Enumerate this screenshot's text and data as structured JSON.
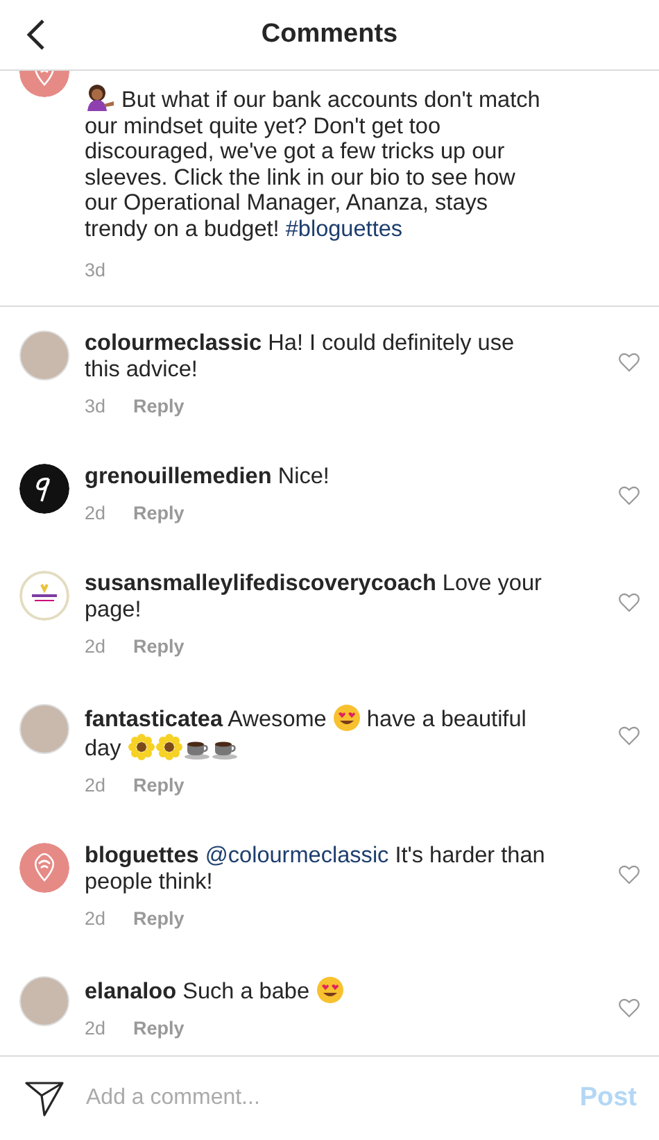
{
  "header": {
    "title": "Comments"
  },
  "caption": {
    "avatar": {
      "kind": "pink-logo"
    },
    "parts": [
      {
        "kind": "person-emoji"
      },
      {
        "kind": "text",
        "text": " But what if our bank accounts don't match our mindset quite yet? Don't get too discouraged, we've got a few tricks up our sleeves. Click the link in our bio to see how our Operational Manager, Ananza, stays trendy on a budget! "
      },
      {
        "kind": "link",
        "text": "#bloguettes"
      }
    ],
    "time": "3d"
  },
  "comments": [
    {
      "avatar": {
        "kind": "photo"
      },
      "username": "colourmeclassic",
      "parts": [
        {
          "kind": "text",
          "text": "Ha! I could definitely use this advice!"
        }
      ],
      "time": "3d",
      "reply": "Reply",
      "liked": false
    },
    {
      "avatar": {
        "kind": "dark-logo"
      },
      "username": "grenouillemedien",
      "parts": [
        {
          "kind": "text",
          "text": "Nice!"
        }
      ],
      "time": "2d",
      "reply": "Reply",
      "liked": false
    },
    {
      "avatar": {
        "kind": "light-logo"
      },
      "username": "susansmalleylifediscoverycoach",
      "parts": [
        {
          "kind": "text",
          "text": "Love your page!"
        }
      ],
      "time": "2d",
      "reply": "Reply",
      "liked": false
    },
    {
      "avatar": {
        "kind": "photo"
      },
      "username": "fantasticatea",
      "parts": [
        {
          "kind": "text",
          "text": "Awesome "
        },
        {
          "kind": "heart-eyes-emoji"
        },
        {
          "kind": "text",
          "text": " have a beautiful day "
        },
        {
          "kind": "sunflower-emoji"
        },
        {
          "kind": "sunflower-emoji"
        },
        {
          "kind": "coffee-emoji"
        },
        {
          "kind": "coffee-emoji"
        }
      ],
      "time": "2d",
      "reply": "Reply",
      "liked": false
    },
    {
      "avatar": {
        "kind": "pink-logo"
      },
      "username": "bloguettes",
      "parts": [
        {
          "kind": "link",
          "text": "@colourmeclassic"
        },
        {
          "kind": "text",
          "text": " It's harder than people think!"
        }
      ],
      "time": "2d",
      "reply": "Reply",
      "liked": false
    },
    {
      "avatar": {
        "kind": "photo"
      },
      "username": "elanaloo",
      "parts": [
        {
          "kind": "text",
          "text": "Such a babe "
        },
        {
          "kind": "heart-eyes-emoji"
        }
      ],
      "time": "2d",
      "reply": "Reply",
      "liked": false
    }
  ],
  "composer": {
    "placeholder": "Add a comment...",
    "post": "Post"
  }
}
